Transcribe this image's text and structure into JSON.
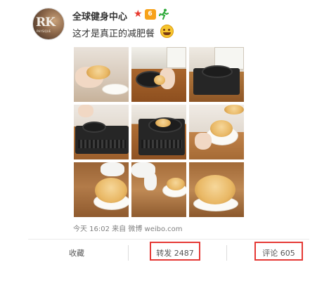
{
  "post": {
    "avatar_initials": "RK",
    "avatar_caption": "PHYSIQUE",
    "username": "全球健身中心",
    "vip_badge_text": "6",
    "text": "这才是真正的减肥餐",
    "emoji": "laughing-tears-emoji",
    "images_count": 9,
    "meta": "今天 16:02 来自 微博 weibo.com"
  },
  "actions": {
    "collect_label": "收藏",
    "repost_label": "转发 2487",
    "comment_label": "评论 605"
  },
  "colors": {
    "highlight_border": "#e53935",
    "badge_orange": "#f7a21a",
    "star_red": "#e8392f",
    "text_main": "#333333",
    "text_meta": "#808080"
  },
  "icons": [
    "star-icon",
    "vip-badge-icon",
    "runner-icon",
    "laughing-emoji-icon"
  ]
}
